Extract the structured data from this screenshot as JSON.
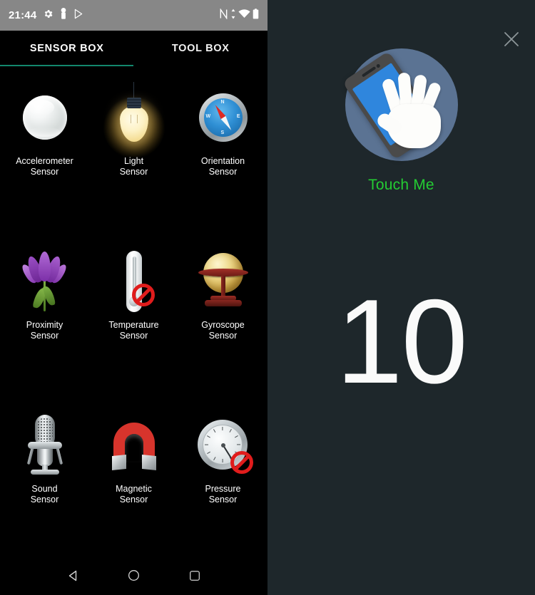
{
  "statusbar": {
    "time": "21:44",
    "left_icons": [
      "gear-icon",
      "pin-icon",
      "play-store-icon"
    ],
    "right_icons": [
      "nfc-icon",
      "data-transfer-icon",
      "wifi-icon",
      "battery-icon"
    ],
    "background": "#878787"
  },
  "tabs": {
    "active_index": 0,
    "accent_color": "#13876d",
    "items": [
      {
        "label": "SENSOR BOX"
      },
      {
        "label": "TOOL BOX"
      }
    ]
  },
  "sensors": {
    "rows": [
      [
        {
          "icon": "sphere-icon",
          "line1": "Accelerometer",
          "line2": "Sensor",
          "disabled": false
        },
        {
          "icon": "lightbulb-icon",
          "line1": "Light",
          "line2": "Sensor",
          "disabled": false
        },
        {
          "icon": "compass-icon",
          "line1": "Orientation",
          "line2": "Sensor",
          "disabled": false
        }
      ],
      [
        {
          "icon": "flower-icon",
          "line1": "Proximity",
          "line2": "Sensor",
          "disabled": false
        },
        {
          "icon": "thermometer-icon",
          "line1": "Temperature",
          "line2": "Sensor",
          "disabled": true
        },
        {
          "icon": "globe-icon",
          "line1": "Gyroscope",
          "line2": "Sensor",
          "disabled": false
        }
      ],
      [
        {
          "icon": "microphone-icon",
          "line1": "Sound",
          "line2": "Sensor",
          "disabled": false
        },
        {
          "icon": "magnet-icon",
          "line1": "Magnetic",
          "line2": "Sensor",
          "disabled": false
        },
        {
          "icon": "gauge-icon",
          "line1": "Pressure",
          "line2": "Sensor",
          "disabled": true
        }
      ]
    ]
  },
  "navbar": {
    "buttons": [
      "back-icon",
      "home-icon",
      "recents-icon"
    ]
  },
  "detail": {
    "background": "#1e272b",
    "close_icon": "close-icon",
    "illustration": "hand-touching-phone-icon",
    "touch_label": "Touch Me",
    "touch_label_color": "#24cc33",
    "count": "10"
  }
}
